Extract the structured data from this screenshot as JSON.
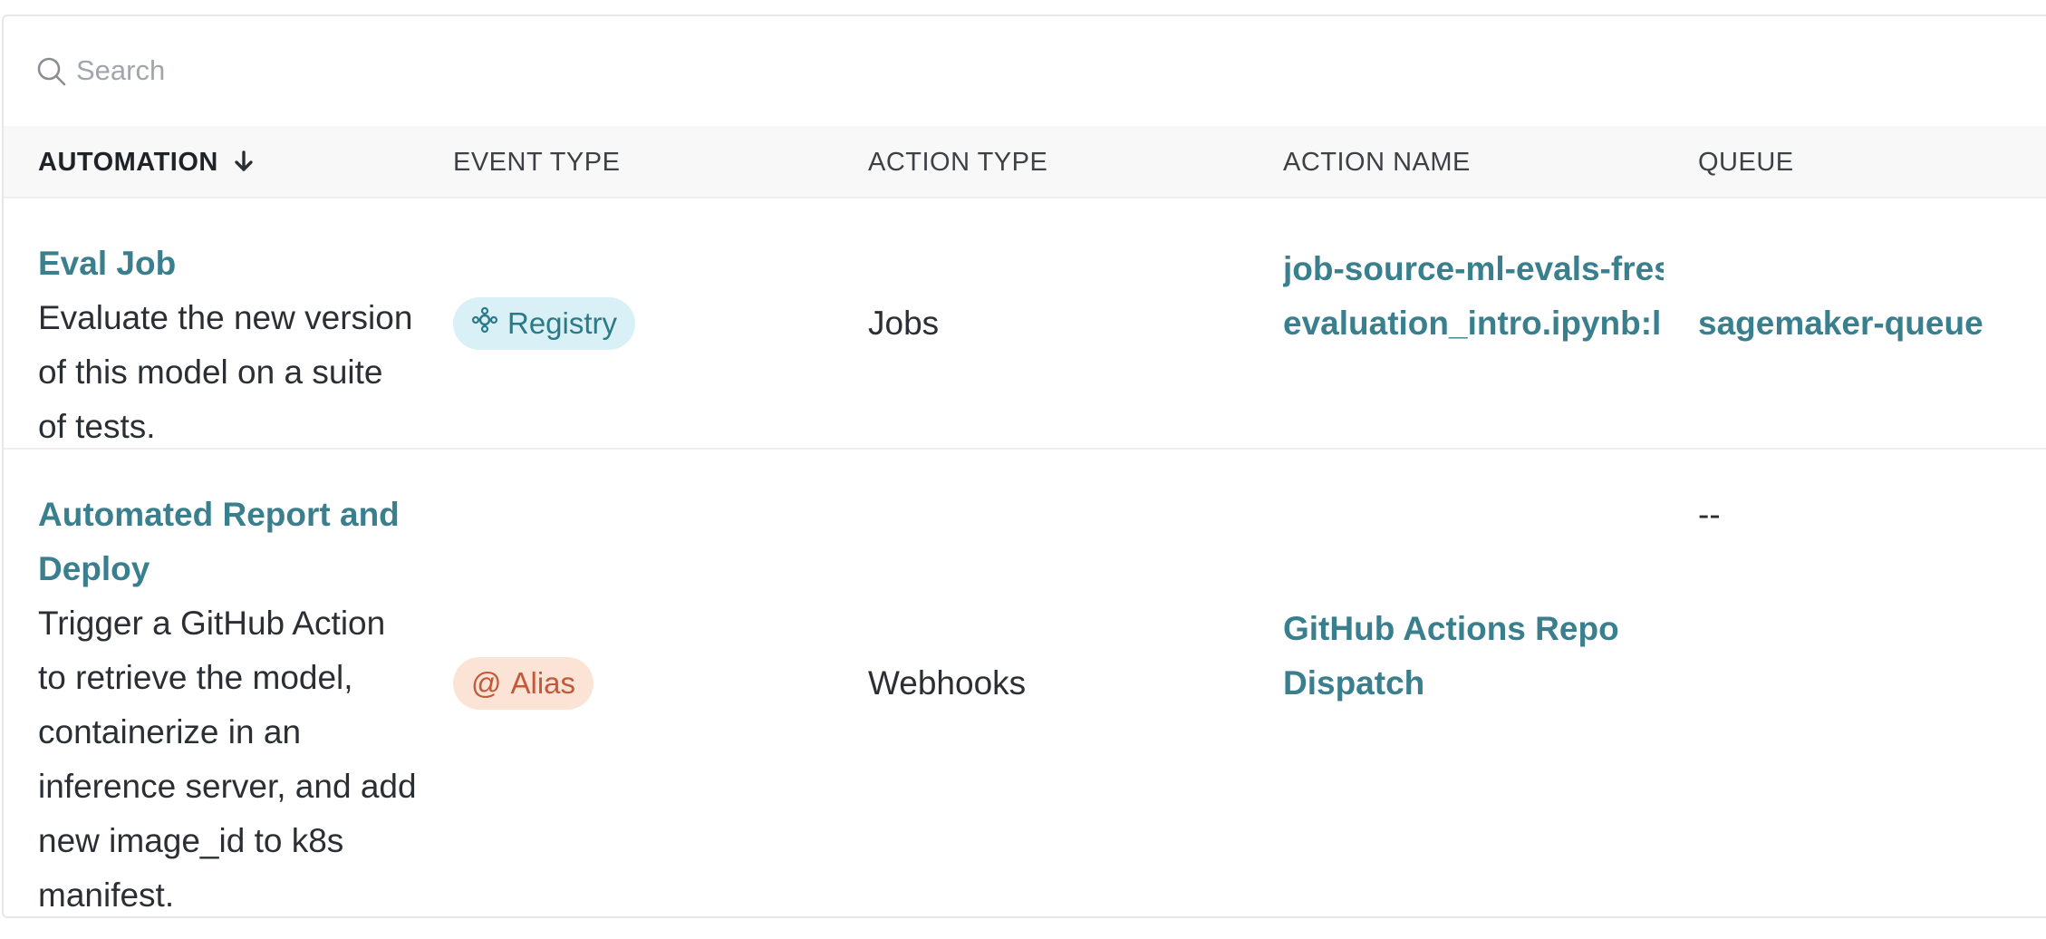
{
  "search": {
    "placeholder": "Search",
    "icon": "search-icon"
  },
  "columns": {
    "automation": "AUTOMATION",
    "event_type": "EVENT TYPE",
    "action_type": "ACTION TYPE",
    "action_name": "ACTION NAME",
    "queue": "QUEUE",
    "sort_icon": "arrow-down-icon"
  },
  "rows": [
    {
      "automation_name": "Eval Job",
      "automation_description": "Evaluate the new version of this model on a suite of tests.",
      "event_type": "Registry",
      "event_icon": "registry-icon",
      "action_type": "Jobs",
      "action_name_line1": "job-source-ml-evals-fres",
      "action_name_line2": "evaluation_intro.ipynb:l",
      "queue": "sagemaker-queue"
    },
    {
      "automation_name": "Automated Report and Deploy",
      "automation_description": "Trigger a GitHub Action to retrieve the model, containerize in an inference server, and add new image_id to k8s manifest.",
      "event_type": "Alias",
      "event_icon": "at-icon",
      "action_type": "Webhooks",
      "action_name_line1": "GitHub Actions Repo",
      "action_name_line2": "Dispatch",
      "queue": "--"
    }
  ],
  "colors": {
    "link": "#3a7f8e",
    "registry_badge_bg": "#d9f1f6",
    "registry_badge_text": "#2c7a87",
    "alias_badge_bg": "#fbe3d6",
    "alias_badge_text": "#c4583a",
    "header_bg": "#f8f8f8"
  }
}
